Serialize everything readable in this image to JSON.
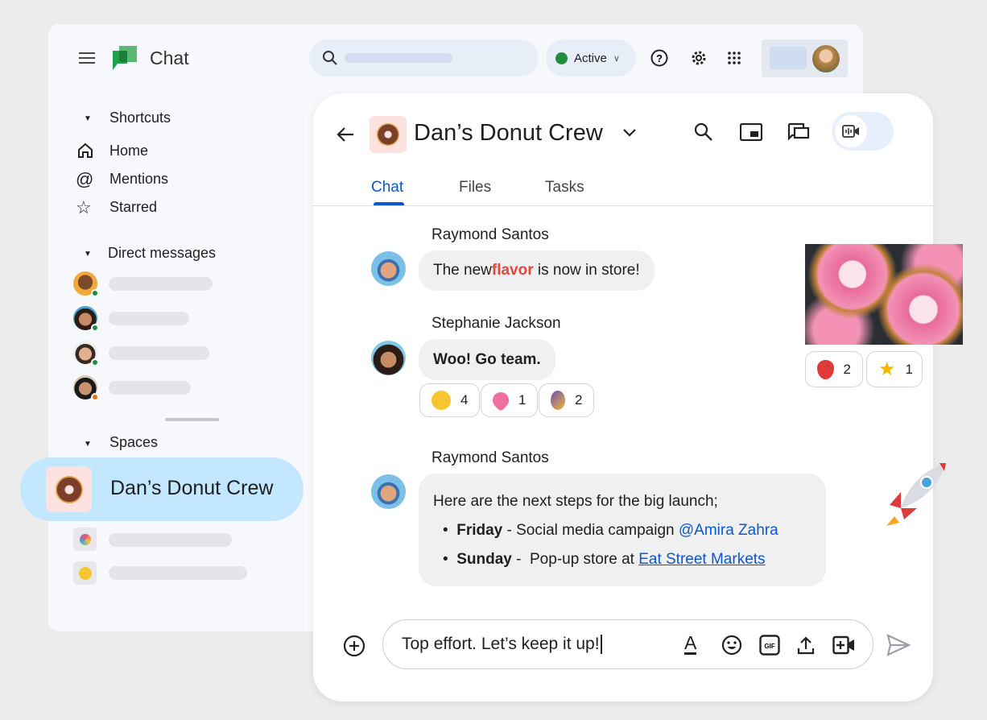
{
  "app": {
    "title": "Chat",
    "status": "Active"
  },
  "sidebar": {
    "shortcuts_label": "Shortcuts",
    "items": [
      {
        "label": "Home",
        "icon": "home-icon"
      },
      {
        "label": "Mentions",
        "icon": "at-icon"
      },
      {
        "label": "Starred",
        "icon": "star-icon"
      }
    ],
    "dm_label": "Direct messages",
    "spaces_label": "Spaces",
    "active_space": "Dan’s Donut Crew"
  },
  "space": {
    "title": "Dan’s Donut Crew",
    "tabs": [
      "Chat",
      "Files",
      "Tasks"
    ],
    "active_tab": "Chat"
  },
  "messages": [
    {
      "sender": "Raymond Santos",
      "pre": "The new ",
      "highlight": "flavor",
      "post": " is now in store!"
    },
    {
      "sender": "Stephanie Jackson",
      "text": "Woo! Go team.",
      "reactions": [
        {
          "emoji": "party-face",
          "count": "4"
        },
        {
          "emoji": "heart",
          "count": "1"
        },
        {
          "emoji": "dancer",
          "count": "2"
        }
      ]
    },
    {
      "sender": "Raymond Santos",
      "intro": "Here are the next steps for the big launch;",
      "bullets": [
        {
          "day": "Friday",
          "sep": " - Social media campaign ",
          "link": "@Amira Zahra"
        },
        {
          "day": "Sunday",
          "sep": " -  Pop-up store at ",
          "link": "Eat Street Markets"
        }
      ]
    }
  ],
  "image_reactions": [
    {
      "emoji": "strawberry",
      "count": "2"
    },
    {
      "emoji": "star",
      "count": "1"
    }
  ],
  "composer": {
    "value": "Top effort. Let’s keep it up!"
  },
  "colors": {
    "accent": "#0b57d0",
    "highlight": "#e8453c",
    "active_space_bg": "#c2e7ff",
    "status_green": "#1e8e3e"
  }
}
